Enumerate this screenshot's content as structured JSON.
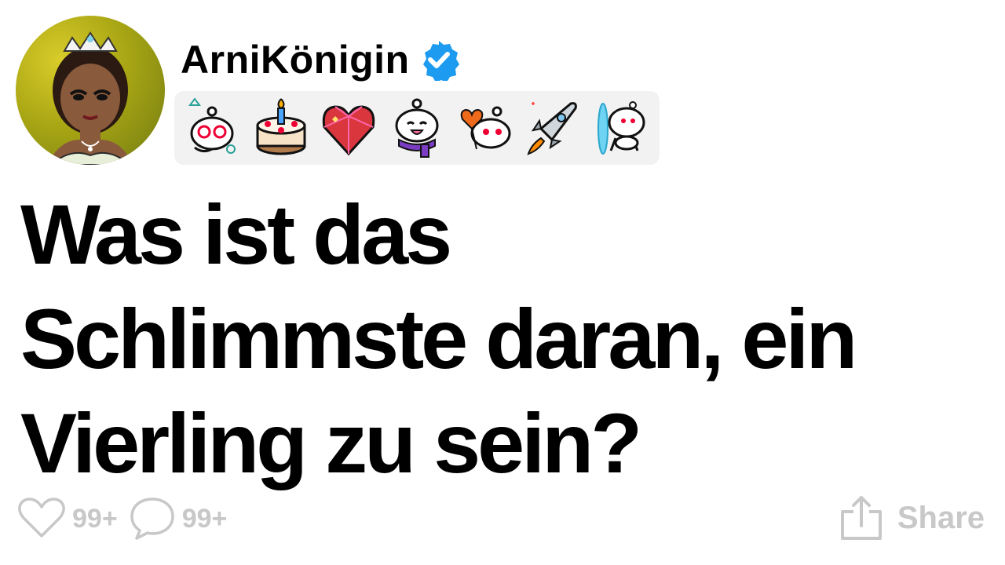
{
  "post": {
    "author": "ArniKönigin",
    "title_lines": [
      "Was ist das",
      "Schlimmste daran, ein",
      "Vierling zu sein?"
    ]
  },
  "badges": [
    {
      "icon": "snoo-3d-glasses-icon"
    },
    {
      "icon": "birthday-cake-icon"
    },
    {
      "icon": "ruby-heart-icon"
    },
    {
      "icon": "snoo-scarf-icon"
    },
    {
      "icon": "snoo-heart-balloons-icon"
    },
    {
      "icon": "rocket-icon"
    },
    {
      "icon": "snoo-portal-icon"
    }
  ],
  "actions": {
    "likes": "99+",
    "comments": "99+",
    "share_label": "Share"
  },
  "colors": {
    "verified": "#1d9bf0",
    "muted": "#c8c8c8",
    "badge_bar": "#f2f2f2",
    "avatar_bg": "#a9a614"
  }
}
